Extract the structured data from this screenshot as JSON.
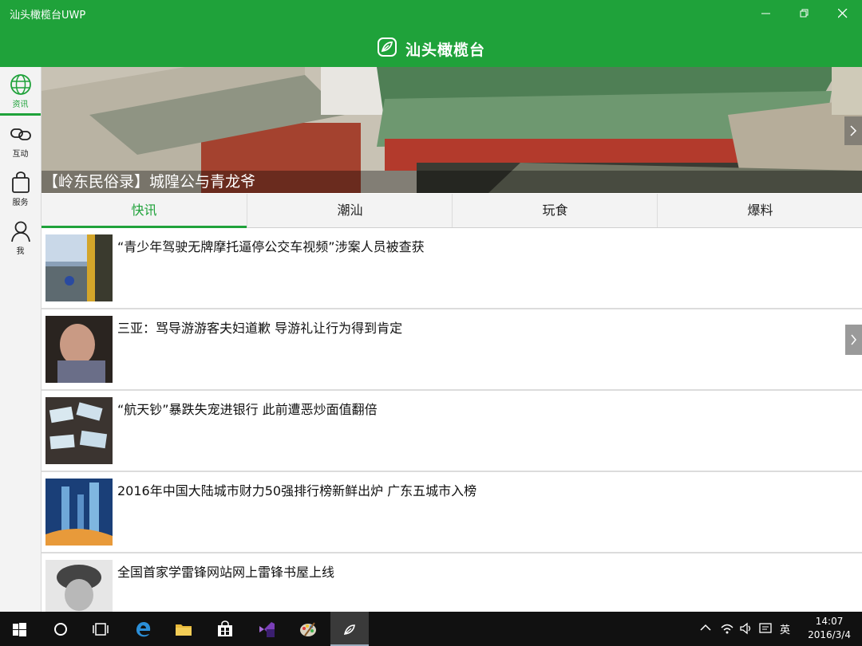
{
  "window": {
    "title": "汕头橄榄台UWP"
  },
  "header": {
    "brand": "汕头橄榄台",
    "logo_icon": "olive-leaf-icon"
  },
  "colors": {
    "accent": "#1fa23a",
    "taskbar": "#111111"
  },
  "nav": {
    "items": [
      {
        "label": "资讯",
        "icon": "globe-icon",
        "active": true
      },
      {
        "label": "互动",
        "icon": "link-icon"
      },
      {
        "label": "服务",
        "icon": "bag-icon"
      },
      {
        "label": "我",
        "icon": "person-icon"
      }
    ]
  },
  "banner": {
    "caption": "【岭东民俗录】城隍公与青龙爷"
  },
  "tabs": [
    {
      "label": "快讯",
      "active": true
    },
    {
      "label": "潮汕"
    },
    {
      "label": "玩食"
    },
    {
      "label": "爆料"
    }
  ],
  "news": [
    {
      "title": "“青少年驾驶无牌摩托逼停公交车视频”涉案人员被查获"
    },
    {
      "title": "三亚：骂导游游客夫妇道歉 导游礼让行为得到肯定"
    },
    {
      "title": "“航天钞”暴跌失宠进银行 此前遭恶炒面值翻倍"
    },
    {
      "title": "2016年中国大陆城市财力50强排行榜新鲜出炉 广东五城市入榜"
    },
    {
      "title": "全国首家学雷锋网站网上雷锋书屋上线"
    }
  ],
  "taskbar": {
    "ime": "英",
    "time": "14:07",
    "date": "2016/3/4"
  }
}
